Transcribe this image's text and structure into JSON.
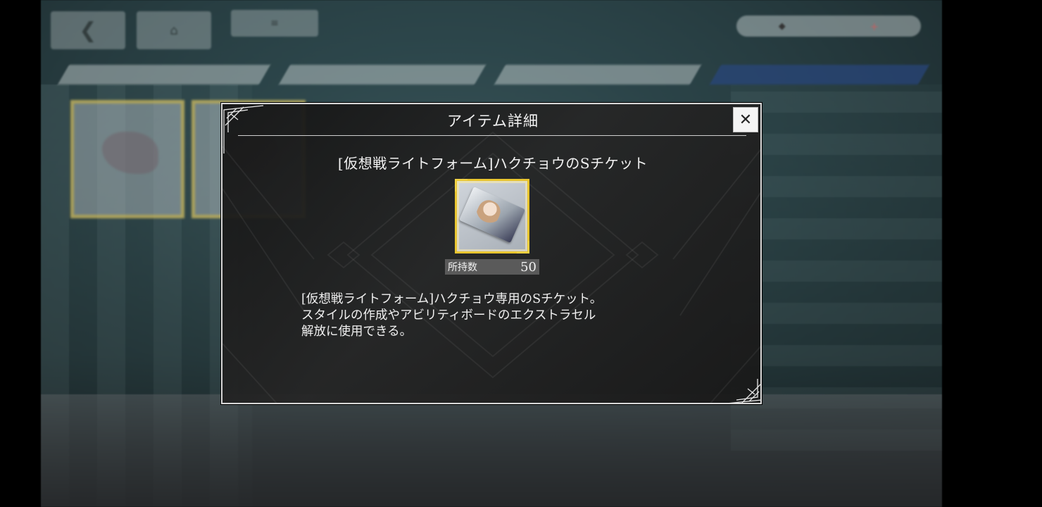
{
  "dialog": {
    "title": "アイテム詳細",
    "close_label": "✕",
    "item_name": "[仮想戦ライトフォーム]ハクチョウのSチケット",
    "owned_label": "所持数",
    "owned_count": "50",
    "description": "[仮想戦ライトフォーム]ハクチョウ専用のSチケット。\nスタイルの作成やアビリティボードのエクストラセル\n解放に使用できる。",
    "icon": "ticket-item-icon"
  },
  "colors": {
    "dialog_bg": "#1e1e1e",
    "frame_gold": "#e8c530",
    "active_tab": "#28468a"
  }
}
